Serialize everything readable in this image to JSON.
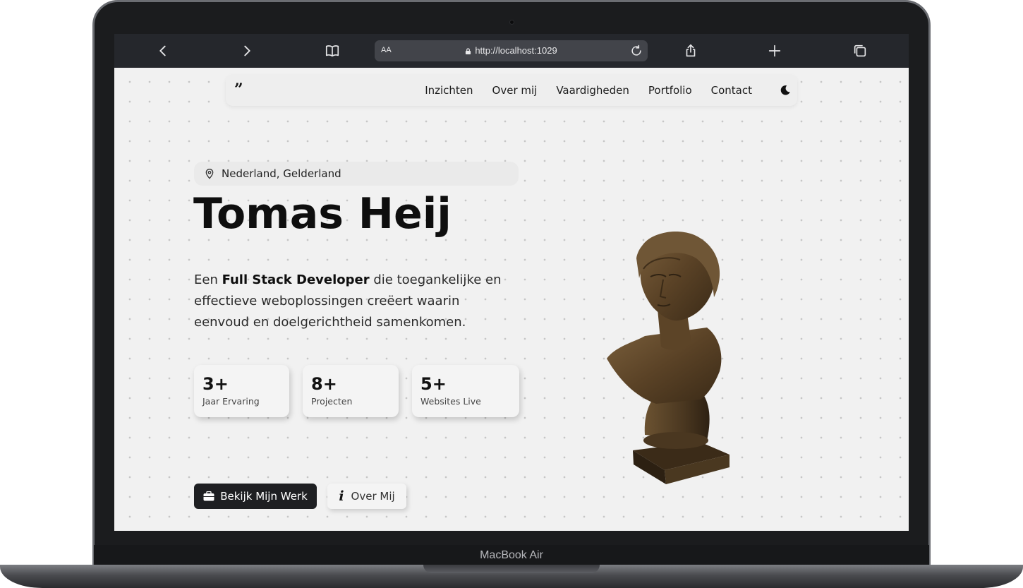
{
  "device": {
    "label": "MacBook Air"
  },
  "browser": {
    "aa_label": "AA",
    "url": "http://localhost:1029"
  },
  "nav": {
    "logo": "”",
    "links": [
      "Inzichten",
      "Over mij",
      "Vaardigheden",
      "Portfolio",
      "Contact"
    ]
  },
  "hero": {
    "location": "Nederland, Gelderland",
    "name": "Tomas Heij",
    "intro_pre": "Een ",
    "intro_bold": "Full Stack Developer",
    "intro_post": " die toegankelijke en effectieve weboplossingen creëert waarin eenvoud en doelgerichtheid samenkomen.",
    "stats": [
      {
        "value": "3+",
        "label": "Jaar Ervaring"
      },
      {
        "value": "8+",
        "label": "Projecten"
      },
      {
        "value": "5+",
        "label": "Websites Live"
      }
    ],
    "primary_button": "Bekijk Mijn Werk",
    "secondary_button": "Over Mij"
  },
  "icons": {
    "back": "chevron-left-icon",
    "forward": "chevron-right-icon",
    "bookmarks": "book-icon",
    "lock": "lock-icon",
    "reload": "reload-icon",
    "share": "share-icon",
    "new_tab": "plus-icon",
    "tabs": "tabs-icon",
    "location": "map-pin-icon",
    "theme": "moon-icon",
    "briefcase": "briefcase-icon",
    "info": "info-icon"
  },
  "colors": {
    "toolbar": "#25272c",
    "page_bg": "#f1f1f1",
    "primary_button": "#1e1f22"
  }
}
